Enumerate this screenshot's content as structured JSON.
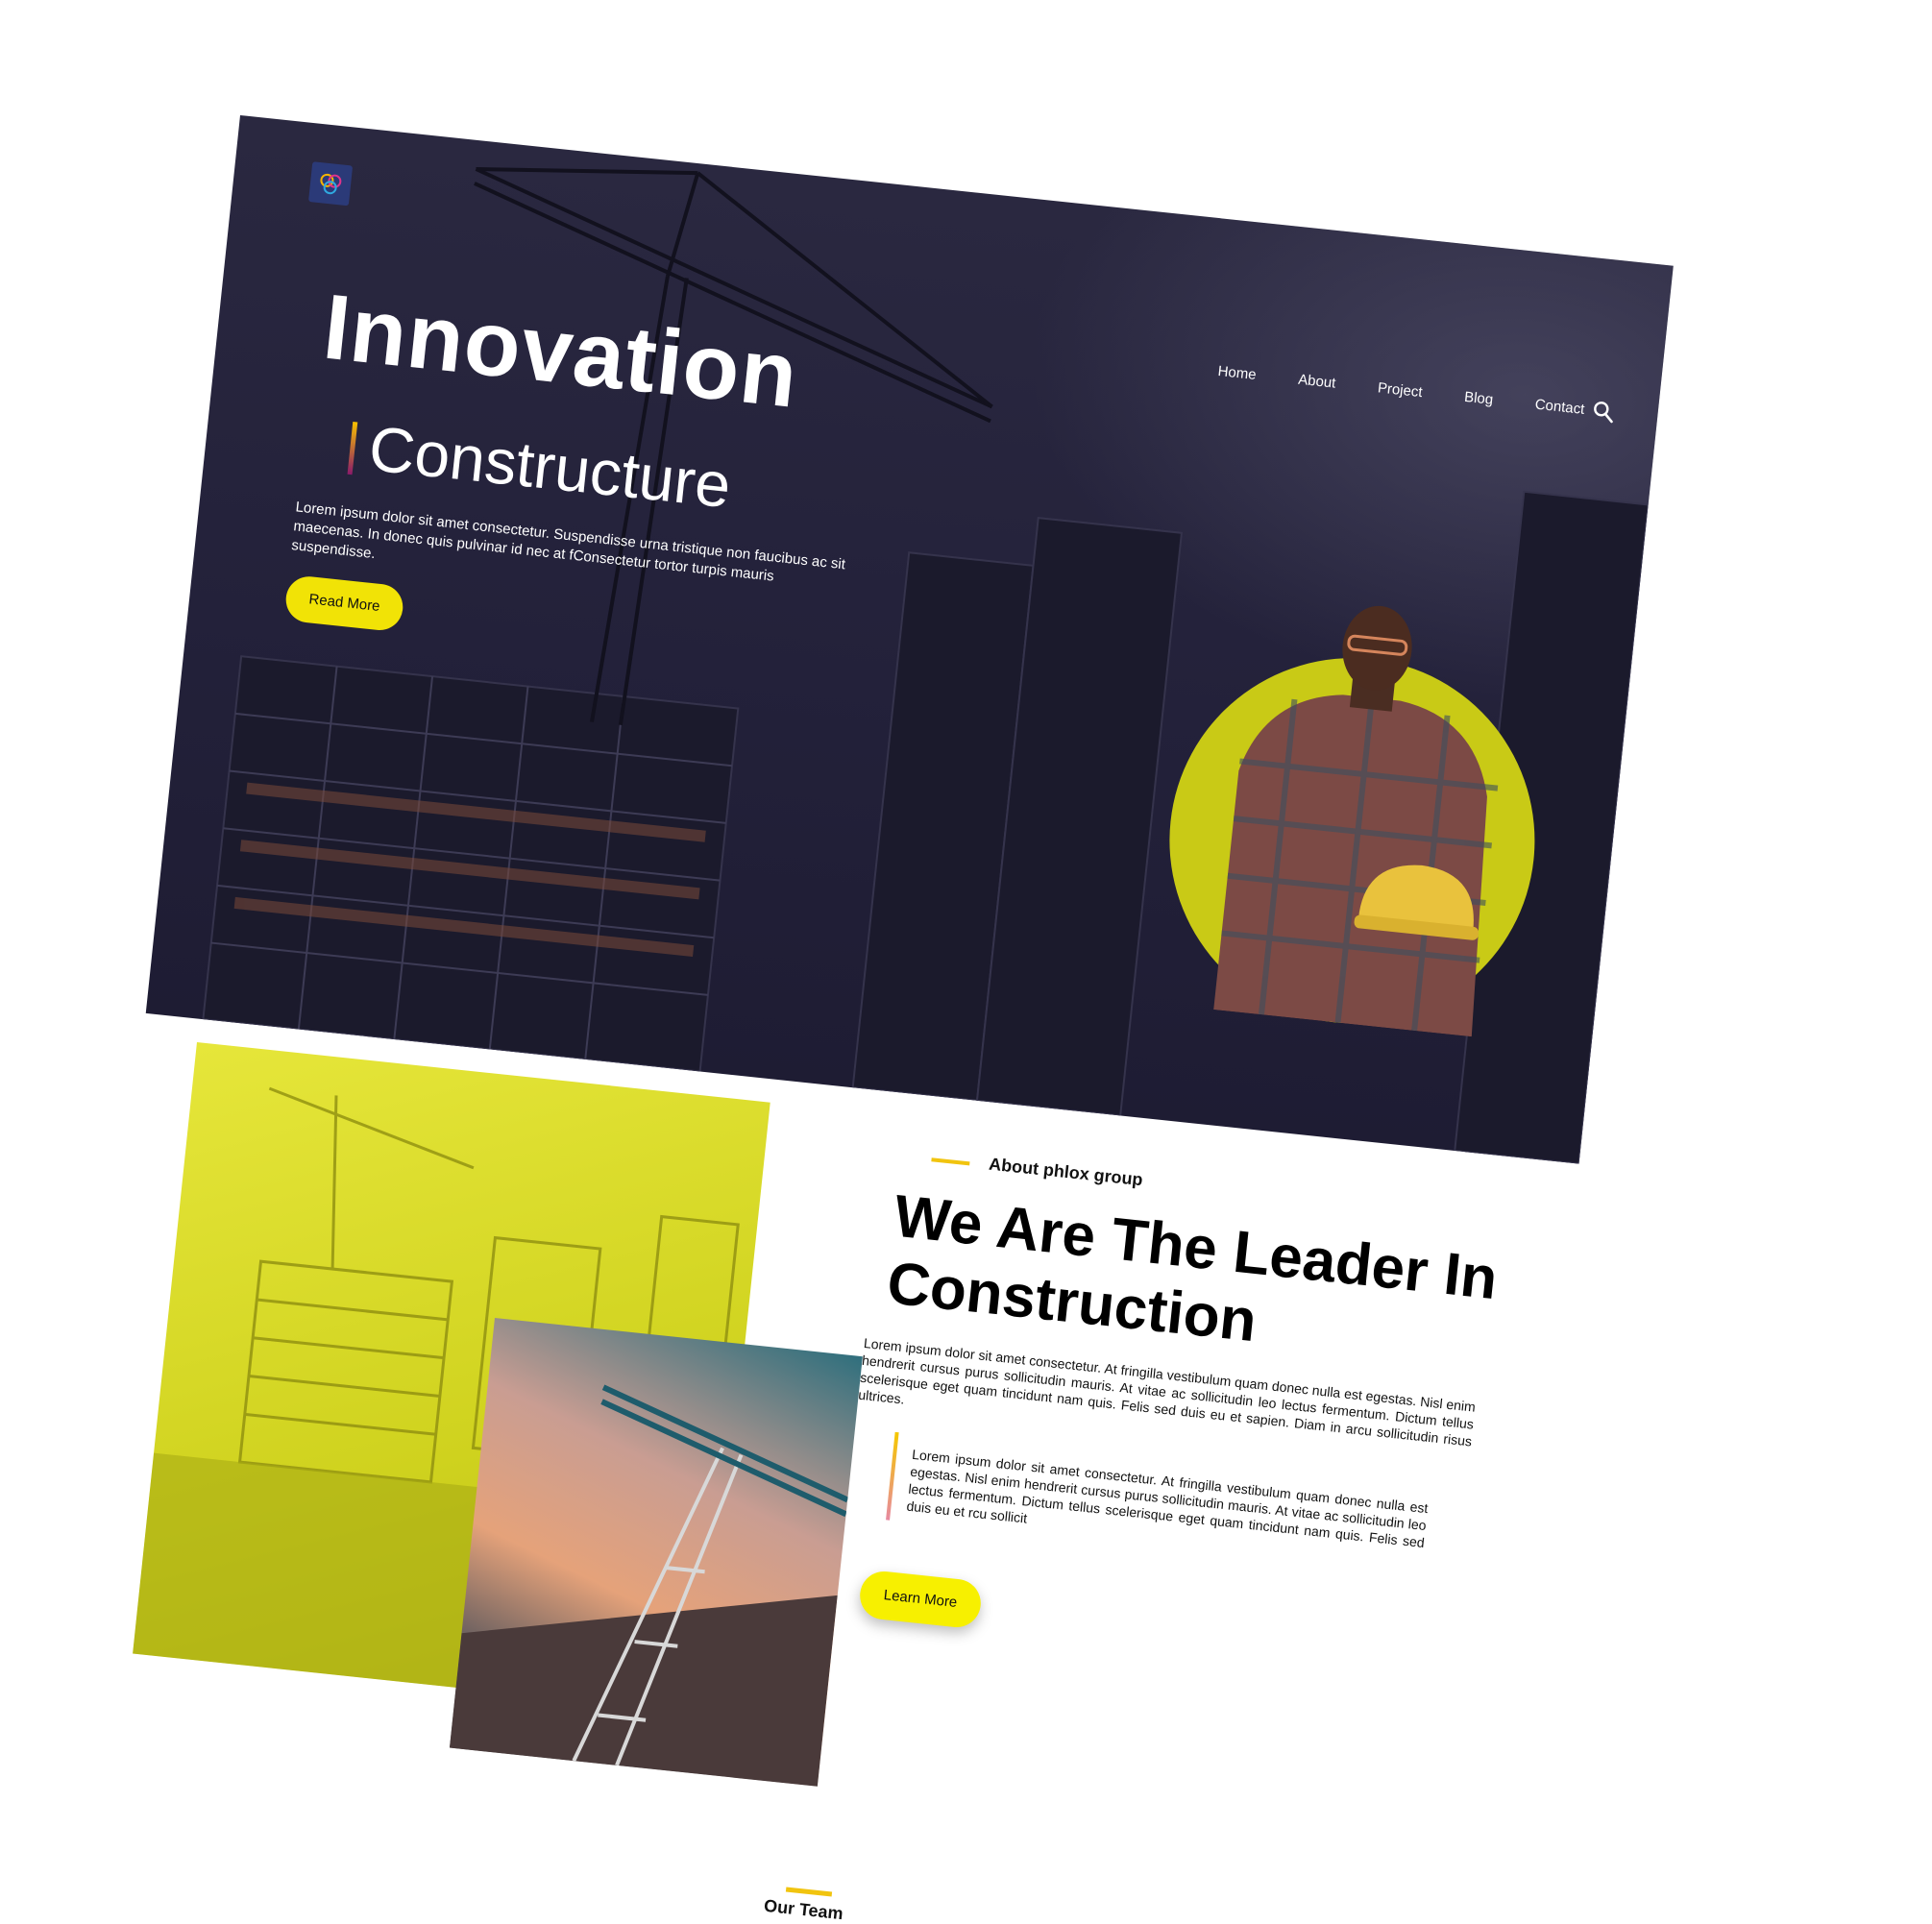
{
  "colors": {
    "hero_bg": "#23213a",
    "accent_yellow": "#f1e306",
    "circle": "#c9ca16",
    "text_dark": "#111111"
  },
  "nav": {
    "items": [
      "Home",
      "About",
      "Project",
      "Blog",
      "Contact"
    ],
    "search_icon": "search-icon"
  },
  "logo": {
    "icon": "logo-icon"
  },
  "hero": {
    "title": "Innovation",
    "subtitle": "Constructure",
    "body": "Lorem ipsum dolor sit amet consectetur. Suspendisse urna tristique non faucibus ac sit maecenas. In donec quis pulvinar id nec at fConsectetur tortor turpis mauris suspendisse.",
    "button": "Read More"
  },
  "about": {
    "kicker": "About phlox group",
    "heading": "We Are The Leader In Construction",
    "paragraph1": "Lorem ipsum dolor sit amet consectetur. At fringilla vestibulum quam donec nulla est egestas. Nisl enim hendrerit cursus purus sollicitudin mauris. At vitae ac sollicitudin leo lectus fermentum. Dictum tellus scelerisque eget quam tincidunt nam quis. Felis sed duis eu et sapien. Diam in arcu sollicitudin risus ultrices.",
    "paragraph2": "Lorem ipsum dolor sit amet consectetur. At fringilla vestibulum quam donec nulla est egestas. Nisl enim hendrerit cursus purus sollicitudin mauris. At vitae ac sollicitudin leo lectus fermentum. Dictum tellus scelerisque eget quam tincidunt nam quis. Felis sed duis eu et rcu sollicit",
    "button": "Learn More"
  },
  "team": {
    "label": "Our Team"
  }
}
